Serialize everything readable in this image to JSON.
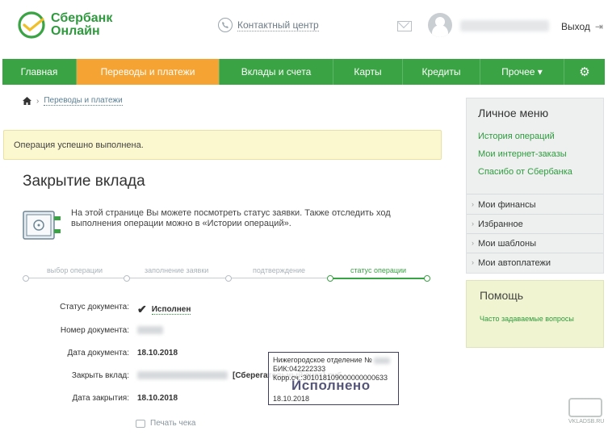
{
  "header": {
    "logo_line1": "Сбербанк",
    "logo_line2": "Онлайн",
    "contact_label": "Контактный центр",
    "logout_label": "Выход"
  },
  "nav": {
    "items": [
      "Главная",
      "Переводы и платежи",
      "Вклады и счета",
      "Карты",
      "Кредиты",
      "Прочее ▾"
    ],
    "active_index": 1,
    "settings_icon": "gear-icon"
  },
  "breadcrumb": {
    "link": "Переводы и платежи"
  },
  "alert": {
    "message": "Операция успешно выполнена."
  },
  "page": {
    "title": "Закрытие вклада",
    "info": "На этой странице Вы можете посмотреть статус заявки. Также отследить ход выполнения операции можно в «Истории операций»."
  },
  "steps": {
    "labels": [
      "выбор операции",
      "заполнение заявки",
      "подтверждение",
      "статус операции"
    ],
    "current": 3
  },
  "details": {
    "status_label": "Статус документа:",
    "status_value": "Исполнен",
    "number_label": "Номер документа:",
    "date_label": "Дата документа:",
    "date_value": "18.10.2018",
    "account_label": "Закрыть вклад:",
    "account_value": "[Сберегательный счет] руб.",
    "close_label": "Дата закрытия:",
    "close_value": "18.10.2018",
    "print_label": "Печать чека"
  },
  "stamp": {
    "line1": "Нижегородское отделение №",
    "line2": "БИК:042222333",
    "line3": "Корр.сч.:301018109000000000633",
    "status": "Исполнено",
    "date": "18.10.2018"
  },
  "sidebar": {
    "menu_title": "Личное меню",
    "links": [
      "История операций",
      "Мои интернет-заказы",
      "Спасибо от Сбербанка"
    ],
    "items": [
      "Мои финансы",
      "Избранное",
      "Мои шаблоны",
      "Мои автоплатежи"
    ],
    "help_title": "Помощь",
    "help_link": "Часто задаваемые вопросы"
  },
  "watermark": {
    "text": "VKLADSB.RU"
  },
  "colors": {
    "green": "#3aa344",
    "orange": "#f5a434",
    "alert_bg": "#fbf7cf"
  }
}
